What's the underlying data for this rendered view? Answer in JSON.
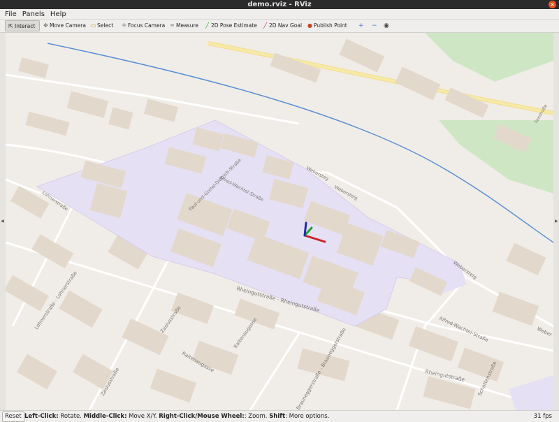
{
  "window": {
    "title": "demo.rviz - RViz",
    "close_glyph": "×"
  },
  "menu": [
    {
      "label": "File"
    },
    {
      "label": "Panels"
    },
    {
      "label": "Help"
    }
  ],
  "toolbar": {
    "tools": [
      {
        "label": "Interact",
        "icon": "interact-icon",
        "active": true
      },
      {
        "label": "Move Camera",
        "icon": "move-camera-icon"
      },
      {
        "label": "Select",
        "icon": "select-icon"
      },
      {
        "label": "Focus Camera",
        "icon": "focus-camera-icon"
      },
      {
        "label": "Measure",
        "icon": "measure-icon"
      },
      {
        "label": "2D Pose Estimate",
        "icon": "pose-estimate-icon",
        "color": "#2aa52a"
      },
      {
        "label": "2D Nav Goal",
        "icon": "nav-goal-icon",
        "color": "#c0209a"
      },
      {
        "label": "Publish Point",
        "icon": "publish-point-icon",
        "color": "#d04020"
      }
    ],
    "add_glyph": "+",
    "remove_glyph": "−",
    "view_glyph": "◉"
  },
  "map": {
    "street_labels": [
      "Alfred-Wachtel-Straße",
      "Paul-und-Gretel-Dietrich-Straße",
      "Webersteg",
      "Webersteig",
      "Rheingutstraße - Rheingutstraße",
      "Lohnerstraße",
      "Lohnerstraße - Lohnerstraße",
      "Zasiusstraße",
      "Raitenaugasse",
      "Brauneggerstraße - Brauneggerstraße",
      "Alfred-Wachtel-Straße",
      "Rheingutstraße",
      "Schottenstraße",
      "Zasiusstraße",
      "Raitenaugasse",
      "Webersteig",
      "Weber",
      "Seestraße"
    ],
    "colors": {
      "background": "#f0ede8",
      "building": "#e3d8cc",
      "campus": "#e6e0f5",
      "river": "#5b8fd6",
      "park": "#cfe6c5",
      "road_major": "#f7e9a8"
    }
  },
  "status": {
    "reset_label": "Reset",
    "hint_left_click": "Left-Click:",
    "hint_left_click_action": " Rotate. ",
    "hint_middle_click": "Middle-Click:",
    "hint_middle_click_action": " Move X/Y. ",
    "hint_right_click": "Right-Click/Mouse Wheel:",
    "hint_right_click_action": ": Zoom. ",
    "hint_shift": "Shift",
    "hint_shift_action": ": More options.",
    "fps": "31 fps"
  }
}
